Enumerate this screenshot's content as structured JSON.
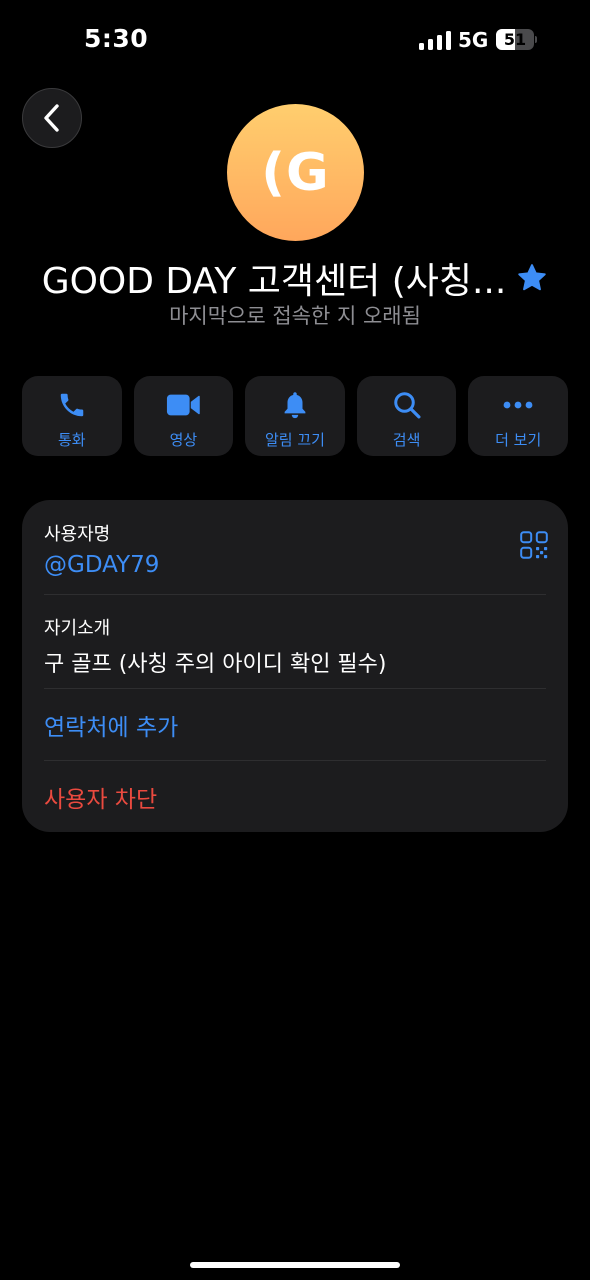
{
  "status_bar": {
    "time": "5:30",
    "network": "5G",
    "battery_level": "51",
    "battery_fraction": 0.51
  },
  "header": {
    "back_icon": "chevron-left-icon"
  },
  "profile": {
    "avatar_initials": "(G",
    "avatar_gradient": [
      "#ffce6e",
      "#ffa75c"
    ],
    "name": "GOOD DAY 고객센터 (사칭...",
    "verified_icon": "star-icon",
    "last_seen": "마지막으로 접속한 지 오래됨"
  },
  "actions": [
    {
      "label": "통화",
      "icon": "phone-icon"
    },
    {
      "label": "영상",
      "icon": "video-camera-icon"
    },
    {
      "label": "알림 끄기",
      "icon": "bell-icon"
    },
    {
      "label": "검색",
      "icon": "search-icon"
    },
    {
      "label": "더 보기",
      "icon": "more-icon"
    }
  ],
  "info": {
    "username_caption": "사용자명",
    "username_value": "@GDAY79",
    "bio_caption": "자기소개",
    "bio_value": "구 골프 (사칭 주의 아이디 확인 필수)",
    "add_contact": "연락처에 추가",
    "block_user": "사용자 차단"
  },
  "colors": {
    "accent": "#3d8df5",
    "danger": "#ea4a3f",
    "card": "#1c1c1e",
    "secondary_text": "#8e8e93"
  }
}
